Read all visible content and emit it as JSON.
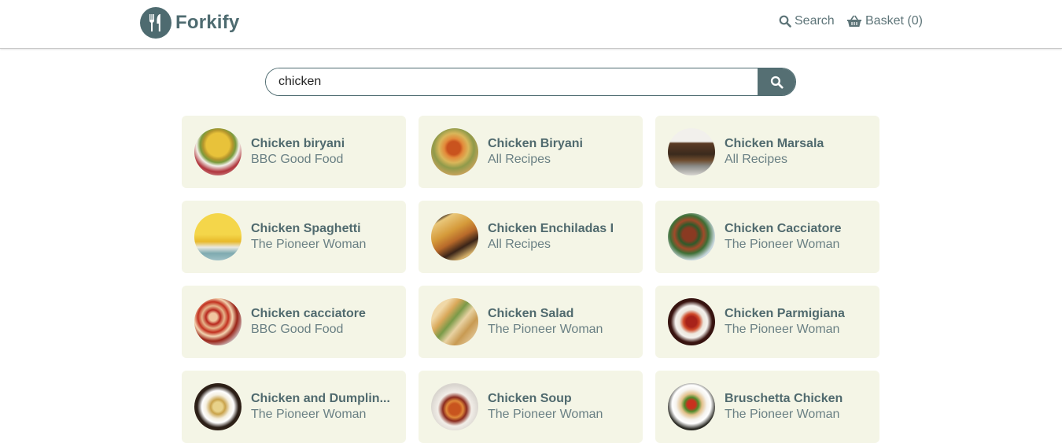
{
  "header": {
    "logo_text": "Forkify",
    "search_label": "Search",
    "basket_label": "Basket (0)"
  },
  "search": {
    "value": "chicken",
    "placeholder": ""
  },
  "colors": {
    "brand": "#4e6b70",
    "card_bg": "#f4f5e6"
  },
  "recipes": [
    {
      "title": "Chicken biryani",
      "source": "BBC Good Food",
      "image": "biryani-bowl-image"
    },
    {
      "title": "Chicken Biryani",
      "source": "All Recipes",
      "image": "biryani-plate-image"
    },
    {
      "title": "Chicken Marsala",
      "source": "All Recipes",
      "image": "marsala-image"
    },
    {
      "title": "Chicken Spaghetti",
      "source": "The Pioneer Woman",
      "image": "spaghetti-image"
    },
    {
      "title": "Chicken Enchiladas I",
      "source": "All Recipes",
      "image": "enchiladas-image"
    },
    {
      "title": "Chicken Cacciatore",
      "source": "The Pioneer Woman",
      "image": "cacciatore-image"
    },
    {
      "title": "Chicken cacciatore",
      "source": "BBC Good Food",
      "image": "cacciatore-tray-image"
    },
    {
      "title": "Chicken Salad",
      "source": "The Pioneer Woman",
      "image": "salad-sandwich-image"
    },
    {
      "title": "Chicken Parmigiana",
      "source": "The Pioneer Woman",
      "image": "parmigiana-image"
    },
    {
      "title": "Chicken and Dumplin...",
      "source": "The Pioneer Woman",
      "image": "dumplings-image"
    },
    {
      "title": "Chicken Soup",
      "source": "The Pioneer Woman",
      "image": "soup-image"
    },
    {
      "title": "Bruschetta Chicken",
      "source": "The Pioneer Woman",
      "image": "bruschetta-image"
    }
  ]
}
